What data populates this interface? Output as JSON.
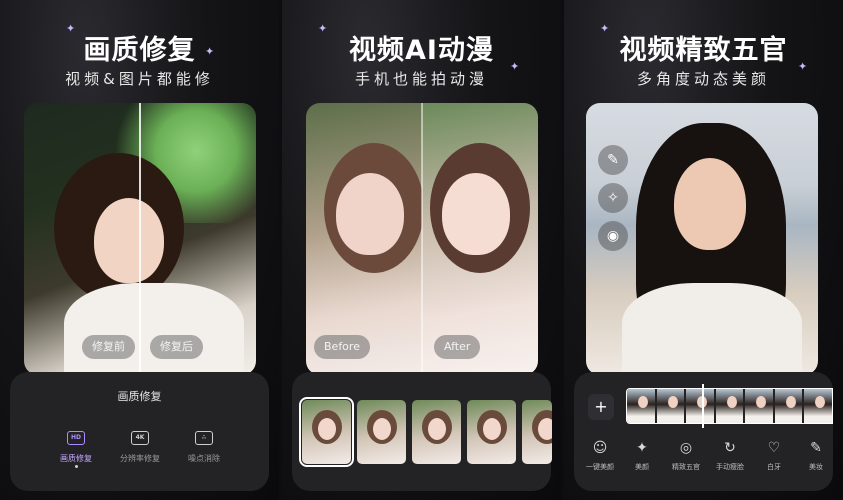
{
  "panel1": {
    "title": "画质修复",
    "subtitle": "视频&图片都能修",
    "before_label": "修复前",
    "after_label": "修复后",
    "sheet_title": "画质修复",
    "tools": [
      {
        "icon_text": "HD",
        "icon": "hd-icon",
        "label": "画质修复",
        "active": true
      },
      {
        "icon_text": "4K",
        "icon": "4k-icon",
        "label": "分辨率修复",
        "active": false
      },
      {
        "icon_text": "",
        "icon": "spot-remove-icon",
        "label": "噪点消除",
        "active": false
      }
    ]
  },
  "panel2": {
    "title": "视频AI动漫",
    "subtitle": "手机也能拍动漫",
    "before_label": "Before",
    "after_label": "After",
    "thumbnails": 5
  },
  "panel3": {
    "title": "视频精致五官",
    "subtitle": "多角度动态美颜",
    "add_label": "+",
    "features": [
      {
        "icon": "face-beauty-icon",
        "glyph": "☺",
        "label": "一键美颜"
      },
      {
        "icon": "magic-wand-icon",
        "glyph": "✦",
        "label": "美颜"
      },
      {
        "icon": "face-shape-icon",
        "glyph": "◎",
        "label": "精致五官"
      },
      {
        "icon": "manual-slim-icon",
        "glyph": "↻",
        "label": "手动瘦脸"
      },
      {
        "icon": "tooth-icon",
        "glyph": "♡",
        "label": "白牙"
      },
      {
        "icon": "makeup-icon",
        "glyph": "✎",
        "label": "美妆"
      }
    ]
  },
  "colors": {
    "accent": "#b08bff",
    "sheet": "#232326",
    "background": "#0d0d0f"
  }
}
